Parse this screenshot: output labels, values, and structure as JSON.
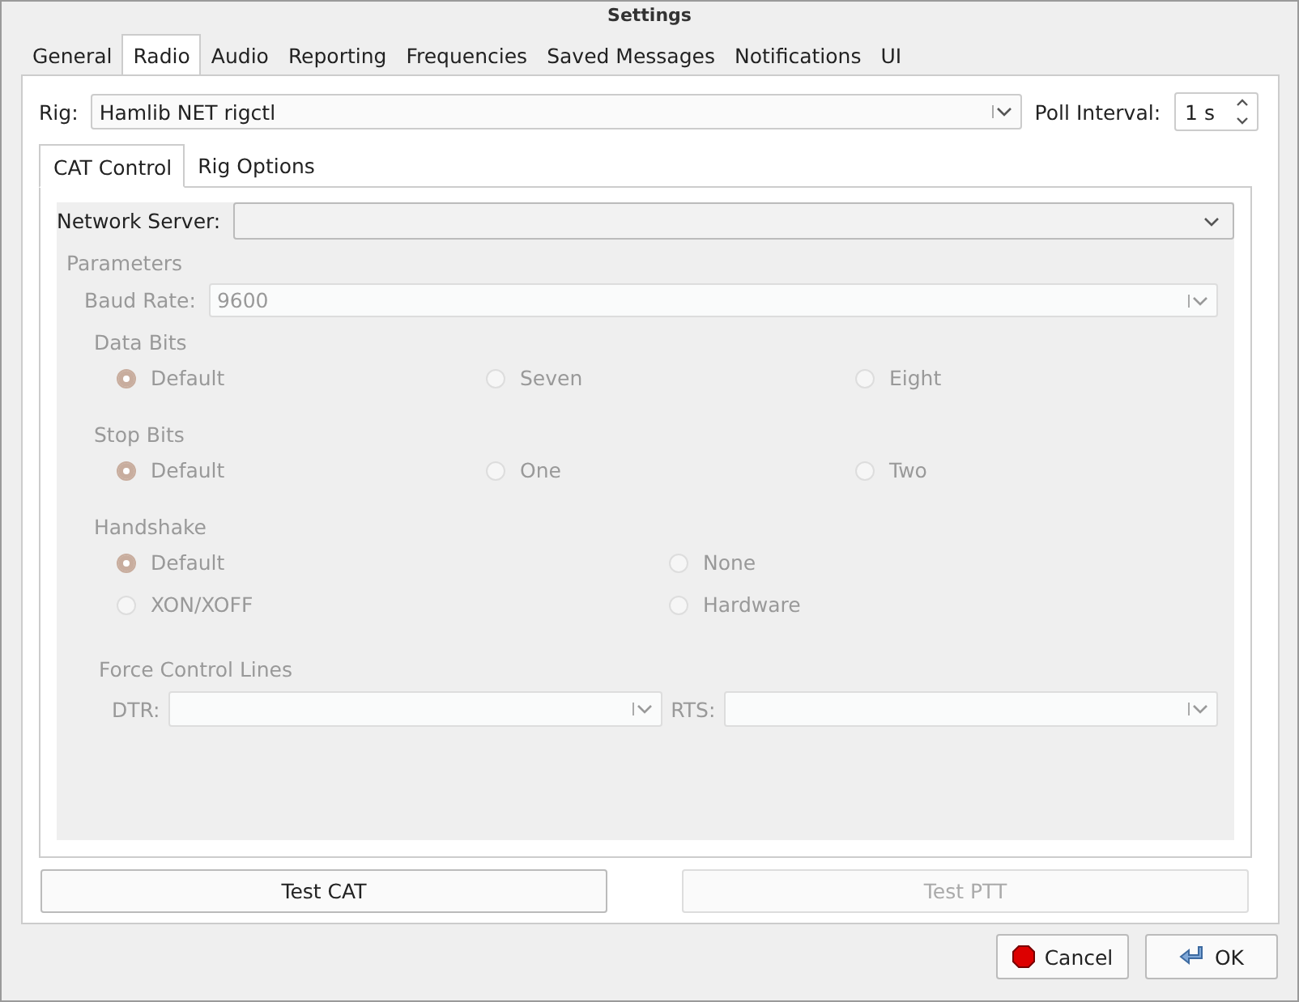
{
  "window": {
    "title": "Settings"
  },
  "tabs": [
    {
      "label": "General",
      "selected": false
    },
    {
      "label": "Radio",
      "selected": true
    },
    {
      "label": "Audio",
      "selected": false
    },
    {
      "label": "Reporting",
      "selected": false
    },
    {
      "label": "Frequencies",
      "selected": false
    },
    {
      "label": "Saved Messages",
      "selected": false
    },
    {
      "label": "Notifications",
      "selected": false
    },
    {
      "label": "UI",
      "selected": false
    }
  ],
  "rig": {
    "label": "Rig:",
    "value": "Hamlib NET rigctl"
  },
  "poll_interval": {
    "label": "Poll Interval:",
    "value": "1 s"
  },
  "inner_tabs": [
    {
      "label": "CAT Control",
      "selected": true
    },
    {
      "label": "Rig Options",
      "selected": false
    }
  ],
  "network_server": {
    "label": "Network Server:"
  },
  "parameters": {
    "title": "Parameters",
    "disabled": true,
    "baud_rate": {
      "label": "Baud Rate:",
      "value": "9600"
    },
    "groups": [
      {
        "title": "Data Bits",
        "options": [
          {
            "label": "Default",
            "selected": true
          },
          {
            "label": "Seven",
            "selected": false
          },
          {
            "label": "Eight",
            "selected": false
          }
        ]
      },
      {
        "title": "Stop Bits",
        "options": [
          {
            "label": "Default",
            "selected": true
          },
          {
            "label": "One",
            "selected": false
          },
          {
            "label": "Two",
            "selected": false
          }
        ]
      },
      {
        "title": "Handshake",
        "options": [
          {
            "label": "Default",
            "selected": true
          },
          {
            "label": "None",
            "selected": false
          },
          {
            "label": "XON/XOFF",
            "selected": false
          },
          {
            "label": "Hardware",
            "selected": false
          }
        ]
      }
    ],
    "force_control_lines": {
      "title": "Force Control Lines",
      "dtr_label": "DTR:",
      "rts_label": "RTS:"
    }
  },
  "test_buttons": [
    {
      "label": "Test CAT",
      "disabled": false
    },
    {
      "label": "Test PTT",
      "disabled": true
    }
  ],
  "dialog_buttons": [
    {
      "label": "Cancel",
      "kind": "cancel"
    },
    {
      "label": "OK",
      "kind": "ok"
    }
  ]
}
